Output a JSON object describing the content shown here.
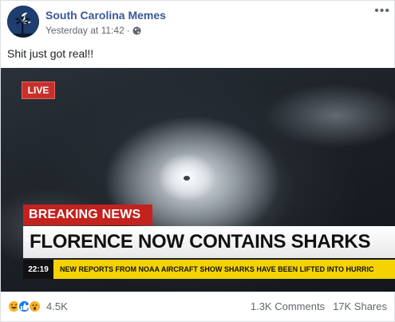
{
  "post": {
    "page_name": "South Carolina Memes",
    "timestamp": "Yesterday at 11:42",
    "separator": "·",
    "privacy_icon": "globe-icon",
    "more_label": "•••",
    "caption": "Shit just got real!!"
  },
  "image": {
    "live_label": "LIVE",
    "breaking_label": "BREAKING NEWS",
    "headline": "FLORENCE NOW CONTAINS SHARKS",
    "ticker_time": "22:19",
    "ticker_text": "NEW REPORTS FROM NOAA AIRCRAFT SHOW SHARKS HAVE BEEN LIFTED INTO HURRIC"
  },
  "engagement": {
    "reaction_icons": [
      "haha-icon",
      "like-icon",
      "wow-icon"
    ],
    "reaction_count": "4.5K",
    "comments": "1.3K Comments",
    "shares": "17K Shares"
  },
  "colors": {
    "link_blue": "#385898",
    "breaking_red": "#c4221d",
    "ticker_yellow": "#f5d300",
    "like_blue": "#1877f2"
  }
}
